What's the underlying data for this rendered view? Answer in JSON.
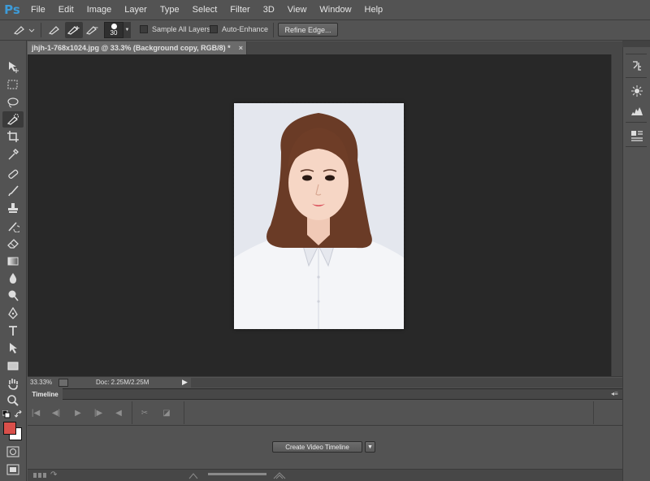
{
  "app": {
    "logo": "Ps",
    "accent": "#3d9bd8"
  },
  "menu": [
    "File",
    "Edit",
    "Image",
    "Layer",
    "Type",
    "Select",
    "Filter",
    "3D",
    "View",
    "Window",
    "Help"
  ],
  "options": {
    "brush_size": "30",
    "sample_all_layers": "Sample All Layers",
    "auto_enhance": "Auto-Enhance",
    "refine_edge": "Refine Edge..."
  },
  "document": {
    "tab_title": "jhjh-1-768x1024.jpg @ 33.3% (Background copy, RGB/8) *",
    "close_glyph": "×"
  },
  "status": {
    "zoom": "33.33%",
    "doc_size": "Doc: 2.25M/2.25M",
    "arrow": "▶"
  },
  "timeline": {
    "tab_label": "Timeline",
    "create_button": "Create Video Timeline",
    "dropdown_glyph": "▼"
  },
  "colors": {
    "foreground": "#d94f4a",
    "background": "#ffffff"
  }
}
